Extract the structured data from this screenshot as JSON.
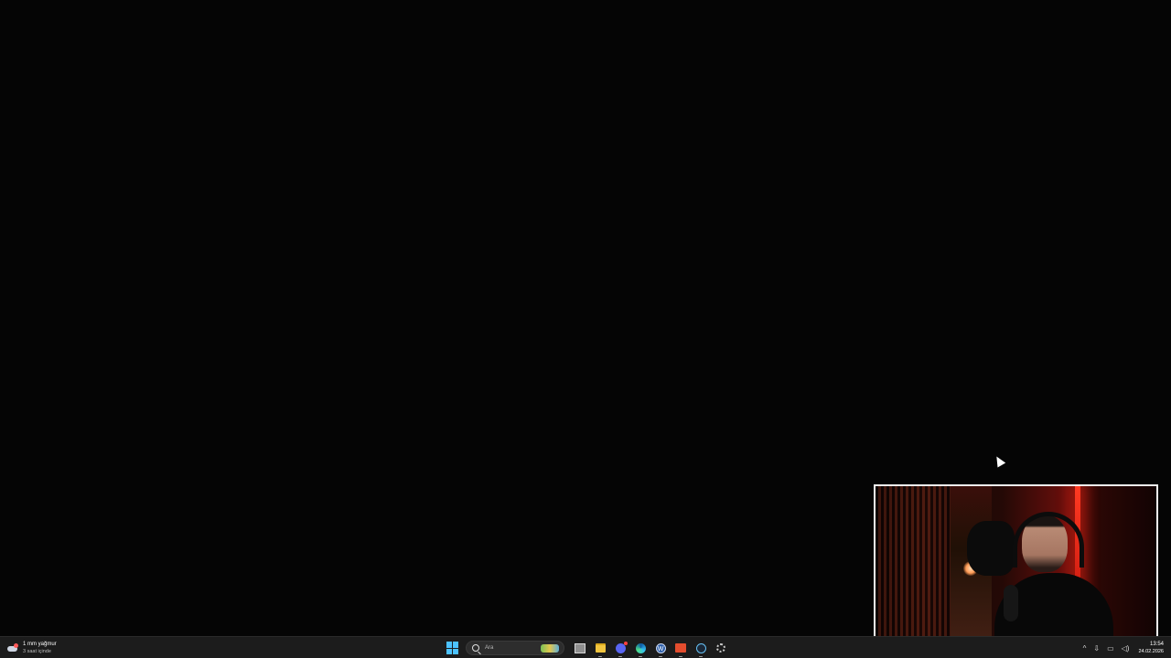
{
  "webcam": {
    "description_hidden": ""
  },
  "taskbar": {
    "weather": {
      "icon": "rain-cloud-icon",
      "temperature_label": "1 mm yağmur",
      "subtitle": "3 saat içinde"
    },
    "search": {
      "placeholder": "Ara"
    },
    "pinned_apps": [
      {
        "name": "task-view-icon"
      },
      {
        "name": "file-explorer-icon"
      },
      {
        "name": "discord-icon"
      },
      {
        "name": "edge-icon"
      },
      {
        "name": "w-app-icon"
      },
      {
        "name": "news-app-icon"
      },
      {
        "name": "steam-icon"
      },
      {
        "name": "settings-gear-icon"
      }
    ],
    "tray": {
      "chevron": "^",
      "time": "13:54",
      "date": "24.02.2026"
    }
  },
  "colors": {
    "desktop_bg": "#050505",
    "taskbar_bg": "#1c1c1c",
    "start_accent": "#4cc2ff"
  }
}
